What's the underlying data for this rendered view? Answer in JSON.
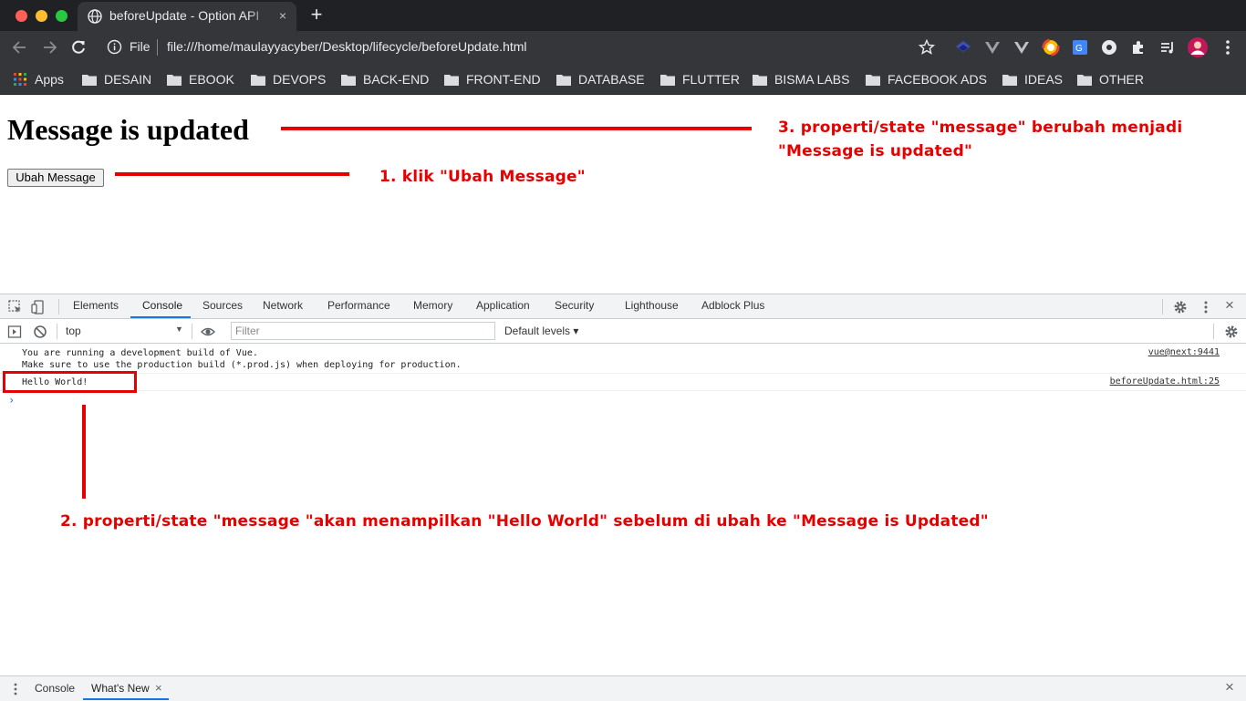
{
  "browser": {
    "tab_title": "beforeUpdate - Option API",
    "tab_close": "×",
    "new_tab": "+",
    "scheme_label": "File",
    "url": "file:///home/maulayyacyber/Desktop/lifecycle/beforeUpdate.html",
    "bookmarks": [
      "Apps",
      "DESAIN",
      "EBOOK",
      "DEVOPS",
      "BACK-END",
      "FRONT-END",
      "DATABASE",
      "FLUTTER",
      "BISMA LABS",
      "FACEBOOK ADS",
      "IDEAS",
      "OTHER"
    ]
  },
  "page": {
    "heading": "Message is updated",
    "button_label": "Ubah Message"
  },
  "devtools": {
    "tabs": [
      "Elements",
      "Console",
      "Sources",
      "Network",
      "Performance",
      "Memory",
      "Application",
      "Security",
      "Lighthouse",
      "Adblock Plus"
    ],
    "active_tab": "Console",
    "context": "top",
    "filter_placeholder": "Filter",
    "levels": "Default levels ▾",
    "messages": [
      {
        "text": "You are running a development build of Vue.\nMake sure to use the production build (*.prod.js) when deploying for production.",
        "source": "vue@next:9441"
      },
      {
        "text": "Hello World!",
        "source": "beforeUpdate.html:25"
      }
    ],
    "prompt": "›",
    "drawer_tabs": [
      "Console",
      "What's New"
    ],
    "drawer_active": "What's New",
    "drawer_tab_close": "×",
    "close": "×"
  },
  "annotations": {
    "step1": "1. klik \"Ubah Message\"",
    "step2": "2. properti/state \"message \"akan menampilkan \"Hello World\" sebelum di ubah ke \"Message is Updated\"",
    "step3_line1": "3. properti/state \"message\" berubah menjadi",
    "step3_line2": "\"Message is updated\"",
    "color": "#e60000"
  },
  "colors": {
    "chrome_dark": "#202124",
    "chrome_toolbar": "#35363a",
    "devtools_bg": "#f1f3f4",
    "accent_blue": "#1a73e8"
  }
}
